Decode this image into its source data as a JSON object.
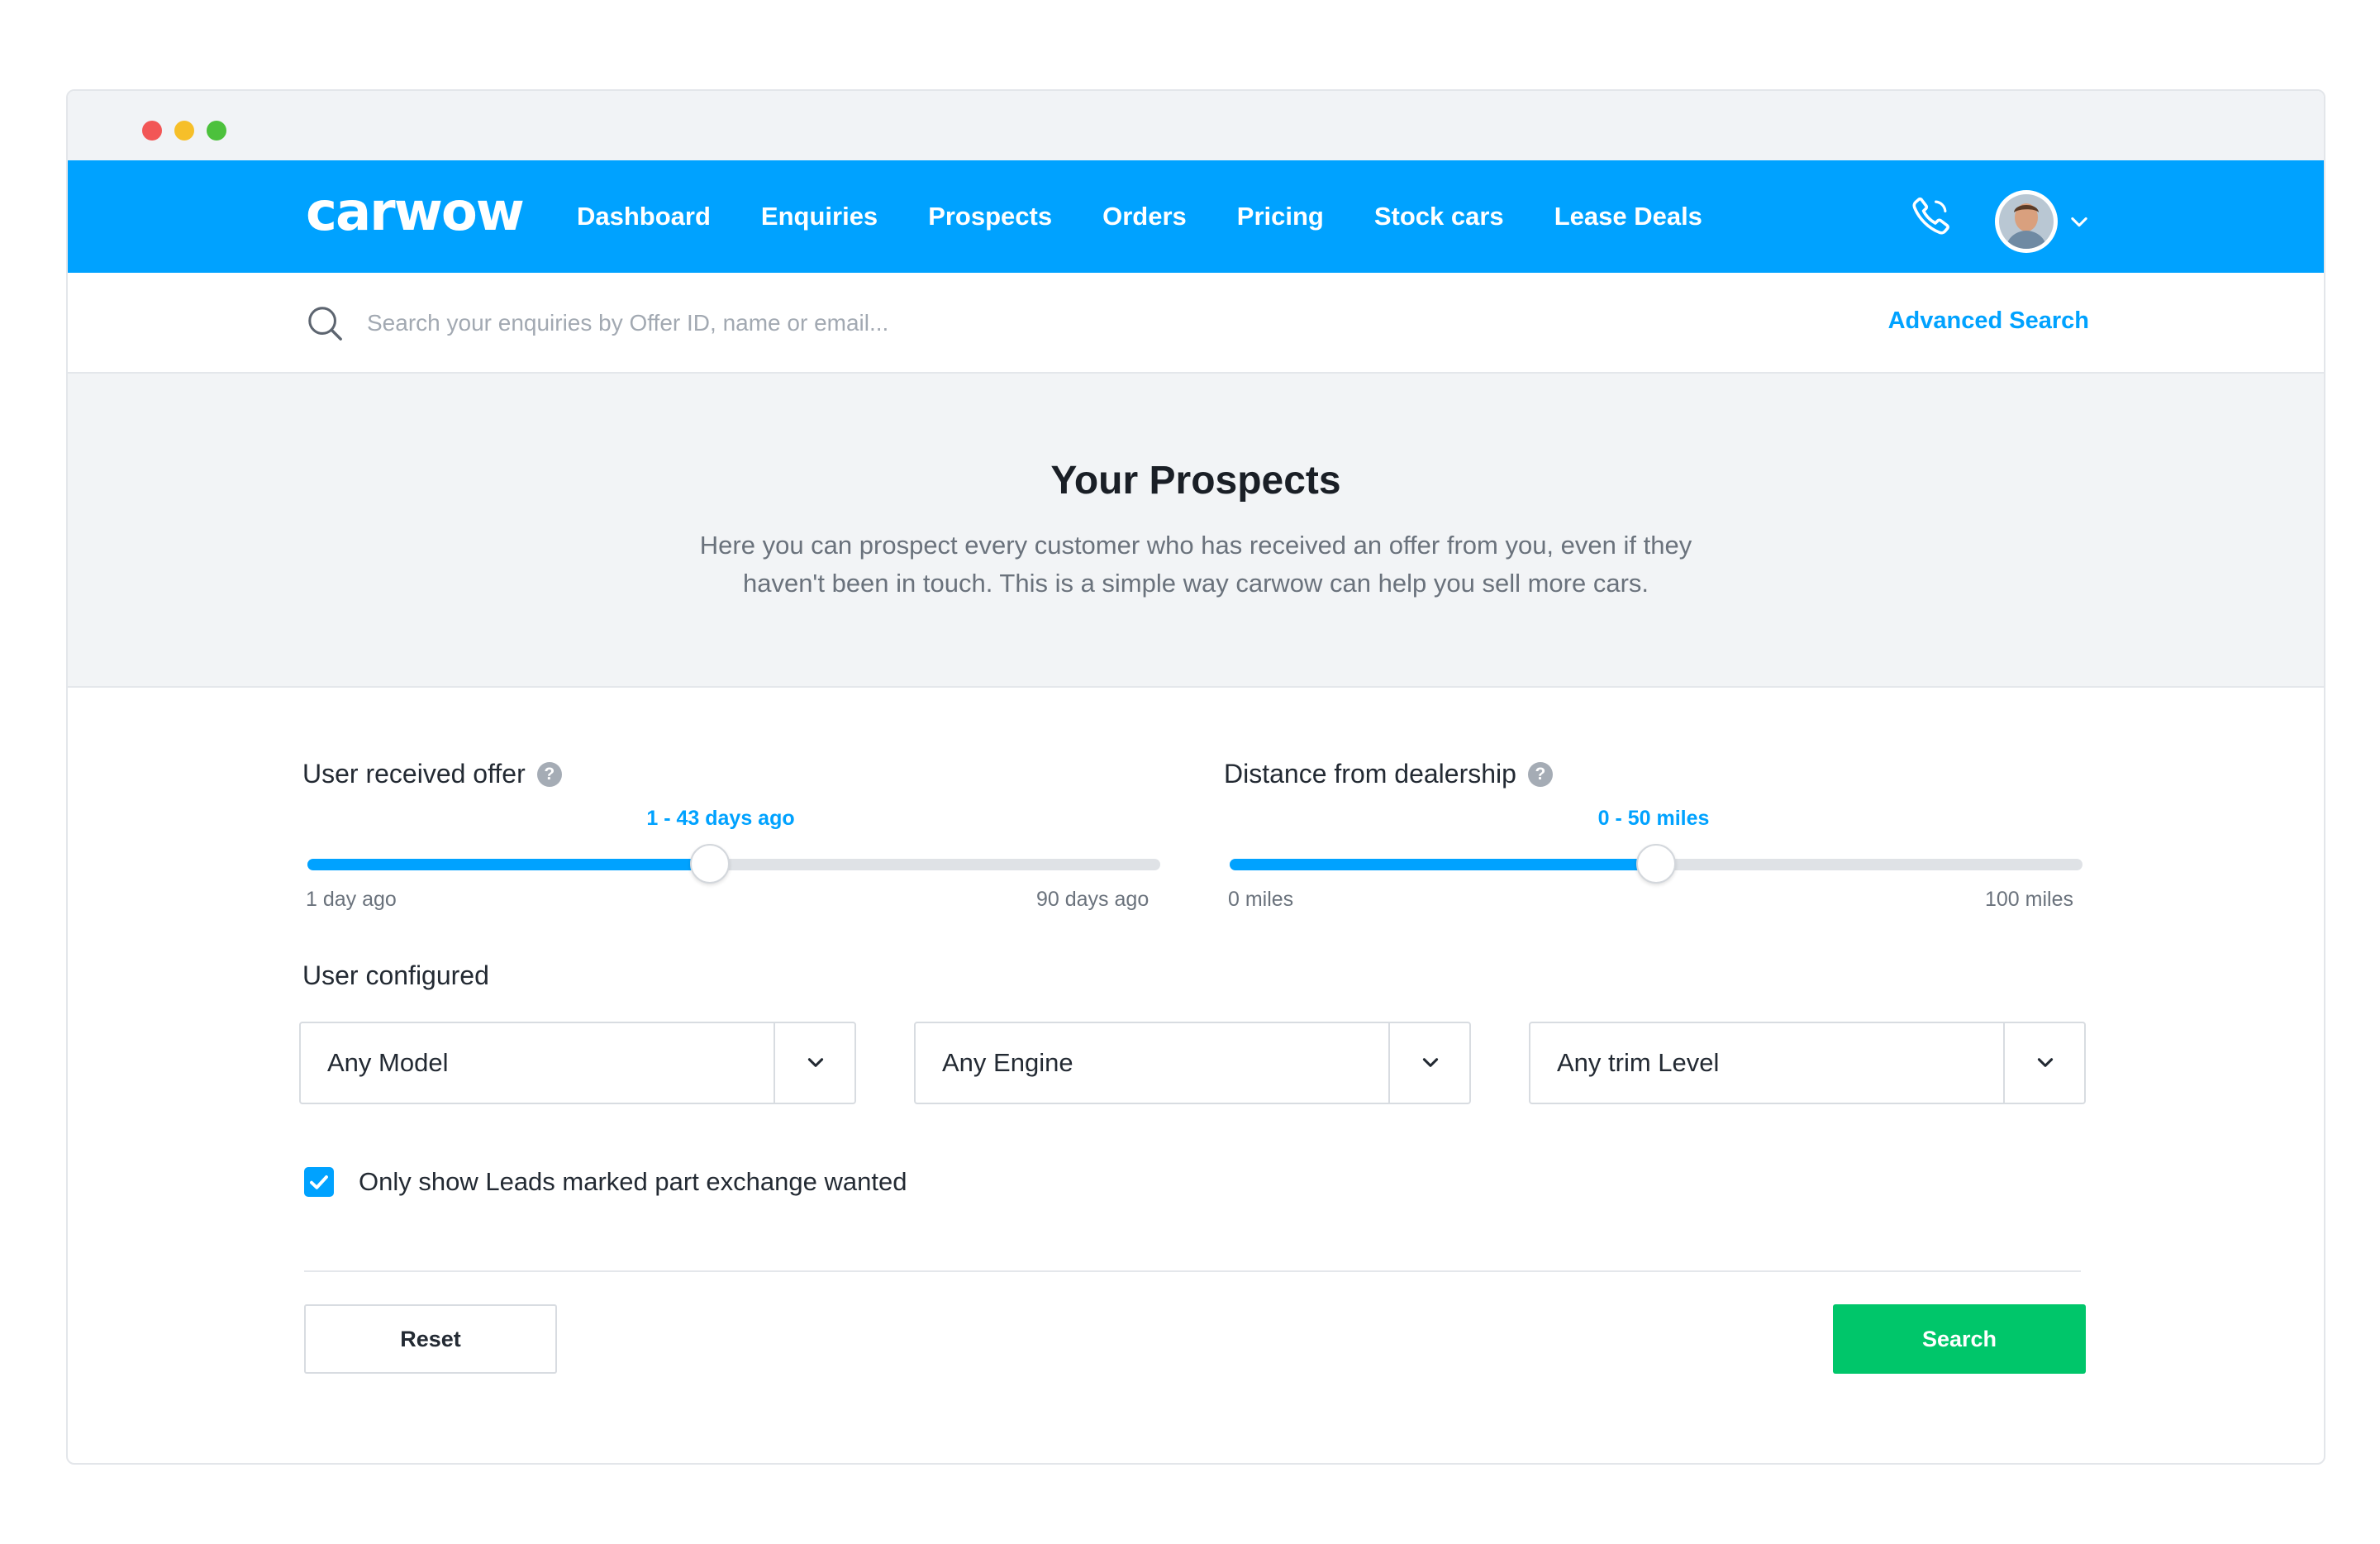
{
  "window": {
    "controls": [
      "close",
      "minimize",
      "maximize"
    ]
  },
  "navbar": {
    "logo": "carwow",
    "links": [
      "Dashboard",
      "Enquiries",
      "Prospects",
      "Orders",
      "Pricing",
      "Stock cars",
      "Lease Deals"
    ],
    "phone_icon": "phone-icon",
    "avatar": "user-avatar",
    "accent_color": "#00a2ff"
  },
  "search": {
    "placeholder": "Search your enquiries by Offer ID, name or email...",
    "value": "",
    "advanced_label": "Advanced Search"
  },
  "hero": {
    "title": "Your Prospects",
    "description": "Here you can prospect every customer who has received an offer from you, even if they haven't been in touch. This is a simple way carwow can help you sell more cars."
  },
  "filters": {
    "offer": {
      "label": "User received offer",
      "value_label": "1 - 43 days ago",
      "min_label": "1 day ago",
      "max_label": "90 days ago",
      "min": 1,
      "max": 90,
      "selected_min": 1,
      "selected_max": 43
    },
    "distance": {
      "label": "Distance from dealership",
      "value_label": "0 - 50 miles",
      "min_label": "0 miles",
      "max_label": "100 miles",
      "min": 0,
      "max": 100,
      "selected_min": 0,
      "selected_max": 50
    },
    "configured": {
      "label": "User configured",
      "model": "Any Model",
      "engine": "Any Engine",
      "trim": "Any trim Level"
    },
    "part_exchange": {
      "label": "Only show Leads marked part exchange wanted",
      "checked": true
    }
  },
  "actions": {
    "reset_label": "Reset",
    "search_label": "Search",
    "search_color": "#00c66a"
  }
}
